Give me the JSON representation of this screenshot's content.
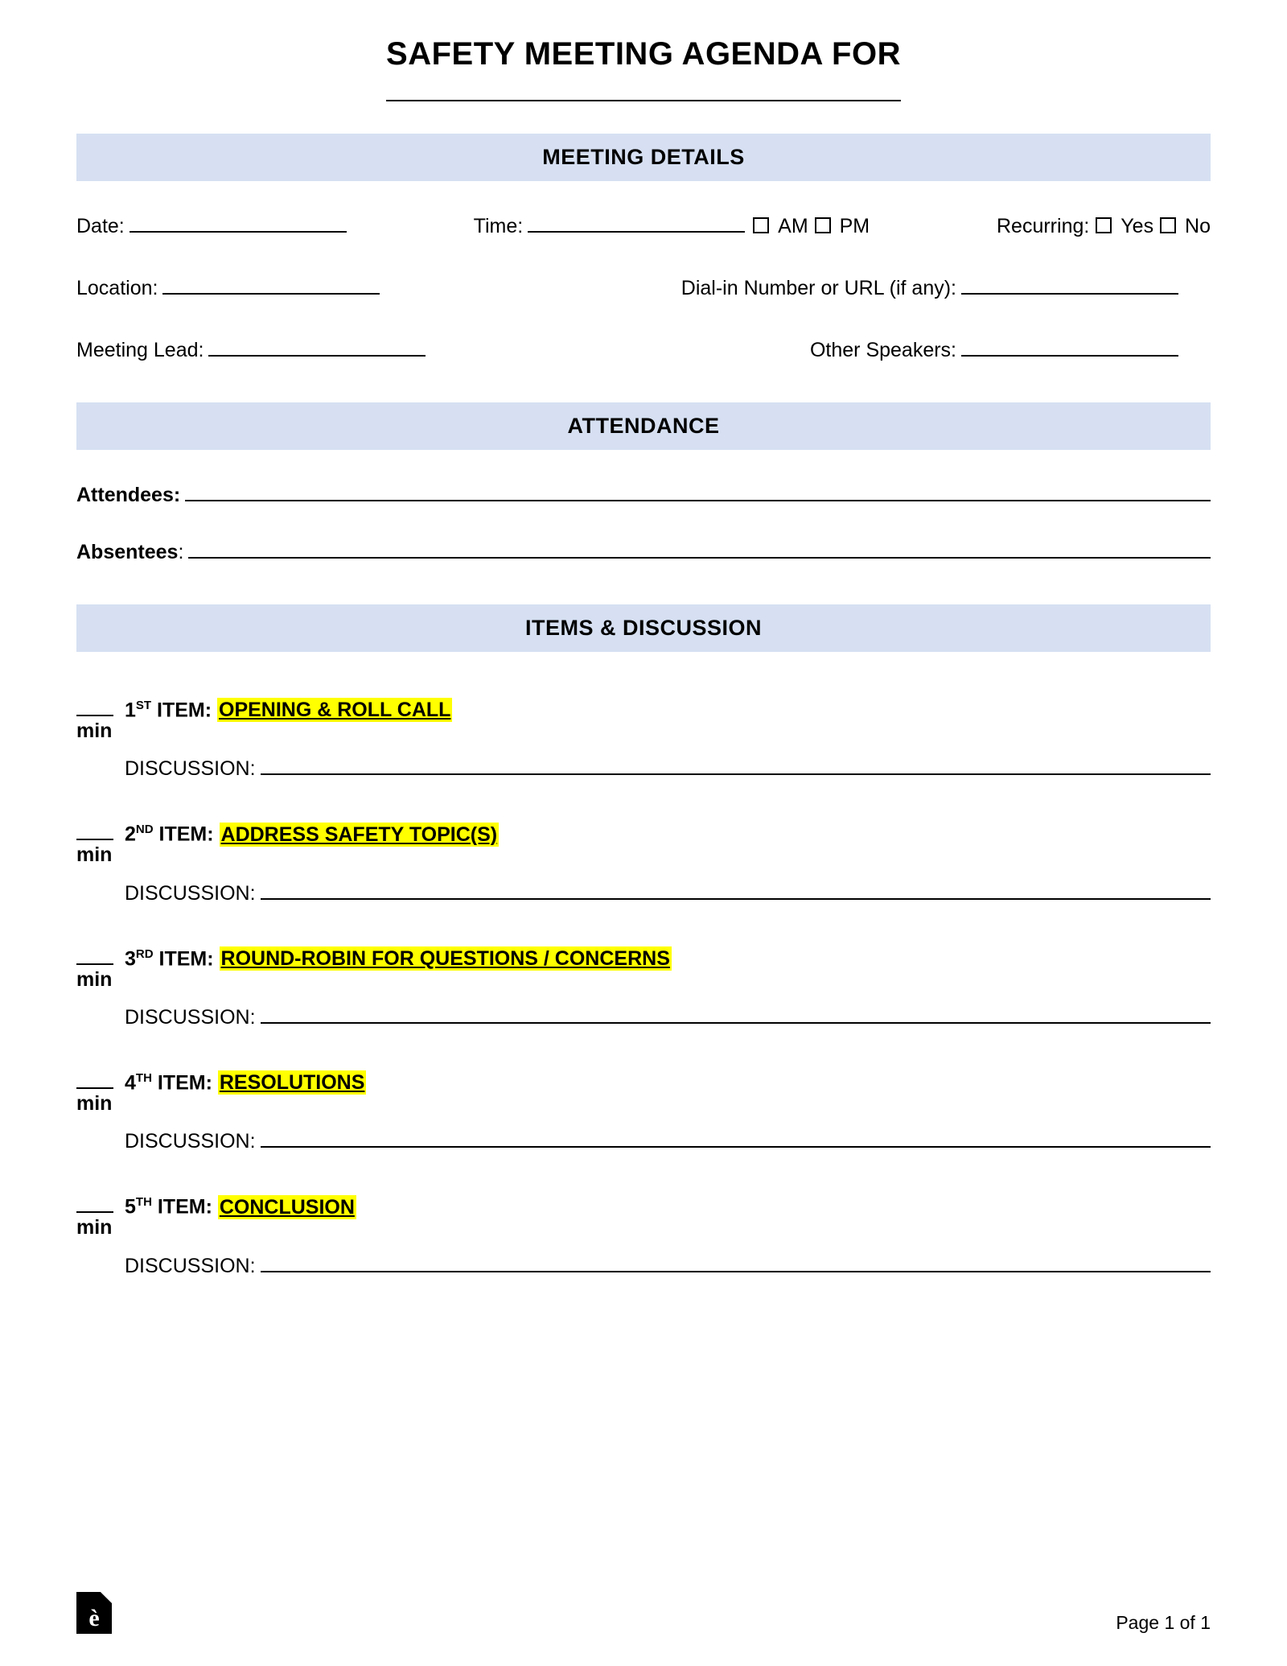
{
  "title": "SAFETY MEETING AGENDA FOR",
  "sections": {
    "details": "MEETING DETAILS",
    "attendance": "ATTENDANCE",
    "items": "ITEMS & DISCUSSION"
  },
  "fields": {
    "date": "Date:",
    "time": "Time:",
    "am": "AM",
    "pm": "PM",
    "recurring": "Recurring:",
    "yes": "Yes",
    "no": "No",
    "location": "Location:",
    "dialin": "Dial-in Number or URL (if any):",
    "lead": "Meeting Lead:",
    "speakers": "Other Speakers:",
    "attendees": "Attendees:",
    "absentees_label": "Absentees",
    "absentees_colon": ":",
    "min": "min",
    "discussion": "DISCUSSION:"
  },
  "items": [
    {
      "ord": "1",
      "sup": "ST",
      "prefix": " ITEM: ",
      "name": "OPENING & ROLL CALL"
    },
    {
      "ord": "2",
      "sup": "ND",
      "prefix": " ITEM: ",
      "name": "ADDRESS SAFETY TOPIC(S)"
    },
    {
      "ord": "3",
      "sup": "RD",
      "prefix": " ITEM: ",
      "name": "ROUND-ROBIN FOR QUESTIONS / CONCERNS"
    },
    {
      "ord": "4",
      "sup": "TH",
      "prefix": " ITEM: ",
      "name": "RESOLUTIONS"
    },
    {
      "ord": "5",
      "sup": "TH",
      "prefix": " ITEM: ",
      "name": "CONCLUSION"
    }
  ],
  "footer": {
    "logo_char": "è",
    "page": "Page 1 of 1"
  }
}
